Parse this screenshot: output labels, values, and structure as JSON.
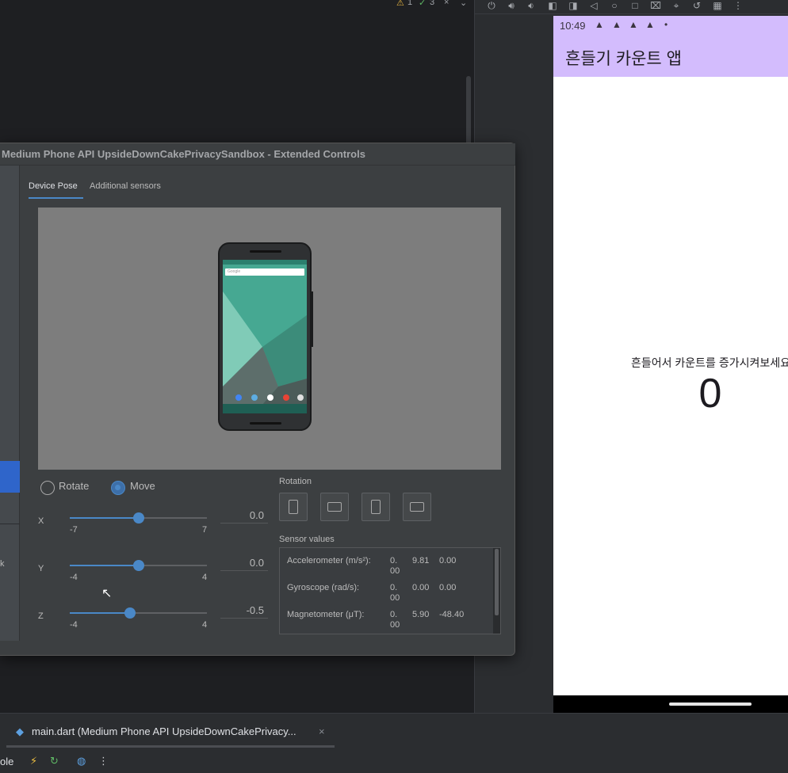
{
  "ide": {
    "warnings_count": "1",
    "checks_count": "3",
    "close_glyph": "×",
    "chevron_glyph": "⌄"
  },
  "emulator": {
    "toolbar_icons": [
      "power-icon",
      "volume-up-icon",
      "volume-down-icon",
      "rotate-left-icon",
      "rotate-right-icon",
      "back-icon",
      "home-icon",
      "overview-icon",
      "screenshot-icon",
      "location-icon",
      "replay-icon",
      "extended-controls-icon",
      "more-icon"
    ],
    "status_time": "10:49",
    "status_dot": "•",
    "app_title": "흔들기 카운트 앱",
    "prompt": "흔들어서 카운트를 증가시켜보세요",
    "count": "0",
    "header_color": "#d3bcfd"
  },
  "dialog": {
    "title": "Medium Phone API UpsideDownCakePrivacySandbox - Extended Controls",
    "sidebar_letter": "k",
    "tabs": [
      "Device Pose",
      "Additional sensors"
    ],
    "active_tab": "Device Pose",
    "preview_search": "Google",
    "mode": {
      "rotate_label": "Rotate",
      "move_label": "Move",
      "selected": "Move"
    },
    "axes": [
      {
        "label": "X",
        "min": "-7",
        "max": "7",
        "value": "0.0",
        "fraction": 0.5
      },
      {
        "label": "Y",
        "min": "-4",
        "max": "4",
        "value": "0.0",
        "fraction": 0.5
      },
      {
        "label": "Z",
        "min": "-4",
        "max": "4",
        "value": "-0.5",
        "fraction": 0.4375
      }
    ],
    "rotation_label": "Rotation",
    "rotation_buttons": [
      "portrait",
      "landscape",
      "reverse-portrait",
      "reverse-landscape"
    ],
    "sensor_values_label": "Sensor values",
    "sensors": [
      {
        "name": "Accelerometer (m/s²):",
        "v1a": "0.",
        "v1b": "00",
        "v2": "9.81",
        "v3": "0.00"
      },
      {
        "name": "Gyroscope (rad/s):",
        "v1a": "0.",
        "v1b": "00",
        "v2": "0.00",
        "v3": "0.00"
      },
      {
        "name": "Magnetometer (μT):",
        "v1a": "0.",
        "v1b": "00",
        "v2": "5.90",
        "v3": "-48.40"
      }
    ],
    "accent_color": "#4a88c7"
  },
  "run_panel": {
    "tab_label": "main.dart (Medium Phone API UpsideDownCakePrivacy...",
    "close_glyph": "×",
    "console_label": "ole",
    "more_glyph": "⋮"
  }
}
